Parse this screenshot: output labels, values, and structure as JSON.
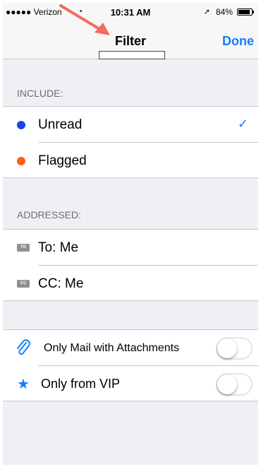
{
  "status_bar": {
    "carrier": "●●●●● Verizon",
    "time": "10:31 AM",
    "battery": "84%"
  },
  "nav": {
    "title": "Filter",
    "done_label": "Done"
  },
  "include": {
    "header": "INCLUDE:",
    "items": [
      {
        "label": "Unread",
        "dot_color": "#1a44f0",
        "checked": true,
        "check_glyph": "✓"
      },
      {
        "label": "Flagged",
        "dot_color": "#ff5b14",
        "checked": false
      }
    ]
  },
  "addressed": {
    "header": "ADDRESSED:",
    "items": [
      {
        "label": "To: Me",
        "icon_text": "TO"
      },
      {
        "label": "CC: Me",
        "icon_text": "CC"
      }
    ]
  },
  "options": {
    "items": [
      {
        "label": "Only Mail with Attachments",
        "icon": "paperclip-icon",
        "on": false
      },
      {
        "label": "Only from VIP",
        "icon": "star-icon",
        "on": false
      }
    ]
  },
  "colors": {
    "accent": "#157efb",
    "background": "#efeff4",
    "separator": "#c8c7cc"
  }
}
